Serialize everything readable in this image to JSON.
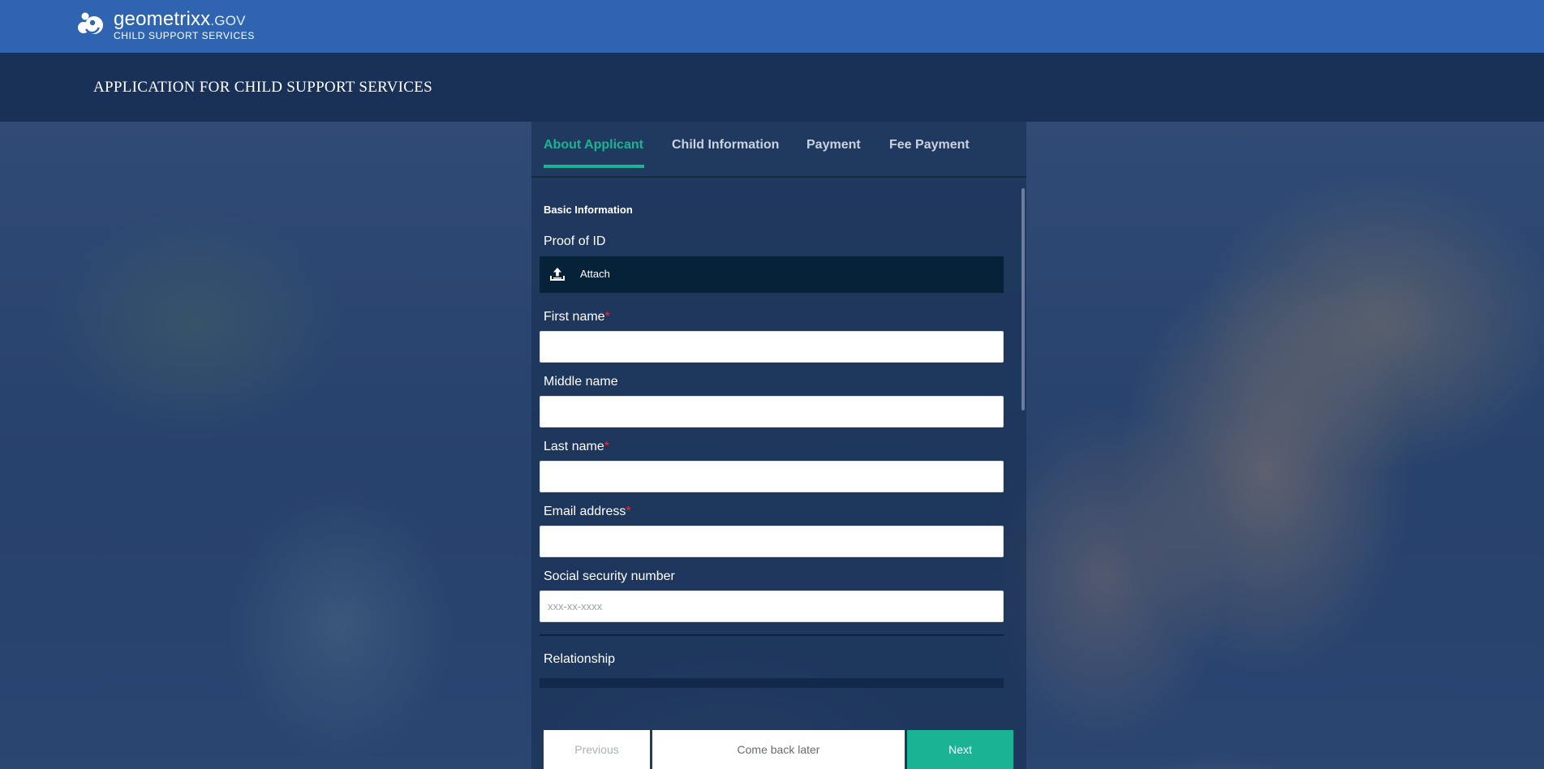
{
  "brand": {
    "name": "geometrixx",
    "name_suffix": ".GOV",
    "subtitle": "CHILD SUPPORT SERVICES",
    "logo_icon": "family-logo-icon"
  },
  "page": {
    "title": "APPLICATION FOR CHILD SUPPORT SERVICES"
  },
  "tabs": [
    {
      "label": "About Applicant",
      "active": true
    },
    {
      "label": "Child Information",
      "active": false
    },
    {
      "label": "Payment",
      "active": false
    },
    {
      "label": "Fee Payment",
      "active": false
    }
  ],
  "form": {
    "section_heading": "Basic Information",
    "proof_of_id": {
      "label": "Proof of ID",
      "button_label": "Attach",
      "icon": "upload-icon"
    },
    "first_name": {
      "label": "First name",
      "required_mark": "*",
      "value": ""
    },
    "middle_name": {
      "label": "Middle name",
      "value": ""
    },
    "last_name": {
      "label": "Last name",
      "required_mark": "*",
      "value": ""
    },
    "email": {
      "label": "Email address",
      "required_mark": "*",
      "value": ""
    },
    "ssn": {
      "label": "Social security number",
      "placeholder": "xxx-xx-xxxx",
      "value": ""
    },
    "relationship": {
      "label": "Relationship"
    }
  },
  "navigation": {
    "previous": "Previous",
    "come_back_later": "Come back later",
    "next": "Next"
  },
  "colors": {
    "brand_bar": "#2f65b0",
    "title_bar": "#1a3157",
    "accent": "#1ab394",
    "required": "#e0333b"
  }
}
